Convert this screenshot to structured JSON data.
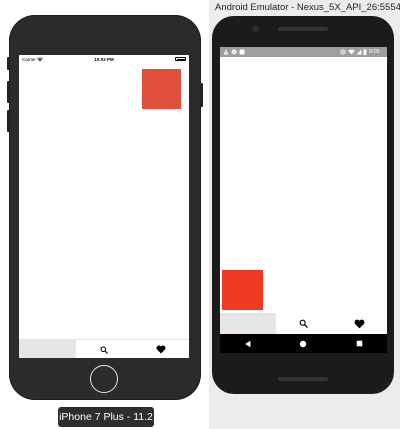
{
  "ios_simulator": {
    "device_label": "iPhone 7 Plus - 11.2",
    "status_bar": {
      "carrier": "Carrier",
      "time": "10:02 PM"
    },
    "red_box_color": "#e0503c",
    "tabs": [
      {
        "icon": "blank",
        "selected": true
      },
      {
        "icon": "search-icon",
        "selected": false
      },
      {
        "icon": "heart-icon",
        "selected": false
      }
    ]
  },
  "android_emulator": {
    "window_title": "Android Emulator - Nexus_5X_API_26:5554",
    "status_bar": {
      "time": "9:05"
    },
    "red_box_color": "#f03a22",
    "tabs": [
      {
        "icon": "blank",
        "selected": true
      },
      {
        "icon": "search-icon",
        "selected": false
      },
      {
        "icon": "heart-icon",
        "selected": false
      }
    ],
    "nav_buttons": [
      "back-icon",
      "home-icon",
      "recents-icon"
    ]
  }
}
